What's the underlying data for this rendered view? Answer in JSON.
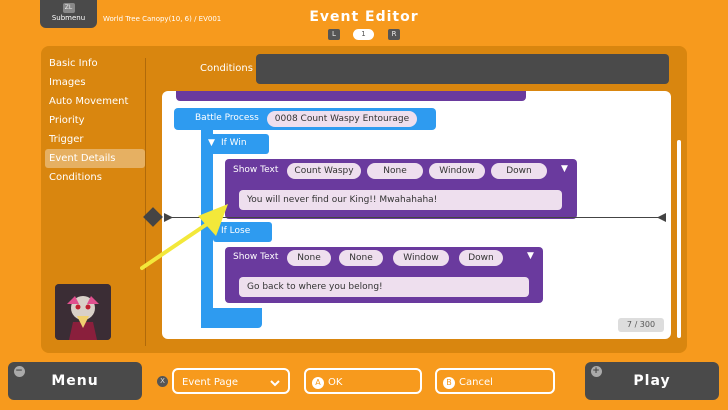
{
  "header": {
    "submenu_button": {
      "key": "ZL",
      "label": "Submenu"
    },
    "map_label": "World Tree Canopy(10, 6) / EV001",
    "title": "Event Editor",
    "page_nav": {
      "left": "L",
      "page": "1",
      "right": "R"
    }
  },
  "sidebar": {
    "items": [
      {
        "label": "Basic Info"
      },
      {
        "label": "Images"
      },
      {
        "label": "Auto Movement"
      },
      {
        "label": "Priority"
      },
      {
        "label": "Trigger"
      },
      {
        "label": "Event Details",
        "active": true
      },
      {
        "label": "Conditions"
      }
    ]
  },
  "conditions": {
    "label": "Conditions",
    "value": ""
  },
  "event_list": {
    "battle": {
      "command": "Battle Process",
      "target": "0008 Count Waspy Entourage"
    },
    "if_win": "If Win",
    "show_text_win": {
      "command": "Show Text",
      "options": [
        "Count Waspy",
        "None",
        "Window",
        "Down"
      ],
      "message": "You will never find our King!! Mwahahaha!"
    },
    "if_lose": "If Lose",
    "show_text_lose": {
      "command": "Show Text",
      "options": [
        "None",
        "None",
        "Window",
        "Down"
      ],
      "message": "Go back to where you belong!"
    },
    "counter": {
      "current": "7",
      "max": "/ 300"
    }
  },
  "footer": {
    "menu": {
      "key": "−",
      "label": "Menu"
    },
    "event_page": {
      "key": "X",
      "label": "Event Page"
    },
    "ok": {
      "key": "A",
      "label": "OK"
    },
    "cancel": {
      "key": "B",
      "label": "Cancel"
    },
    "play": {
      "key": "+",
      "label": "Play"
    }
  },
  "colors": {
    "background": "#f79a1d",
    "panel": "#d9860f",
    "blue": "#2e9bf0",
    "purple": "#6a3a9e"
  }
}
